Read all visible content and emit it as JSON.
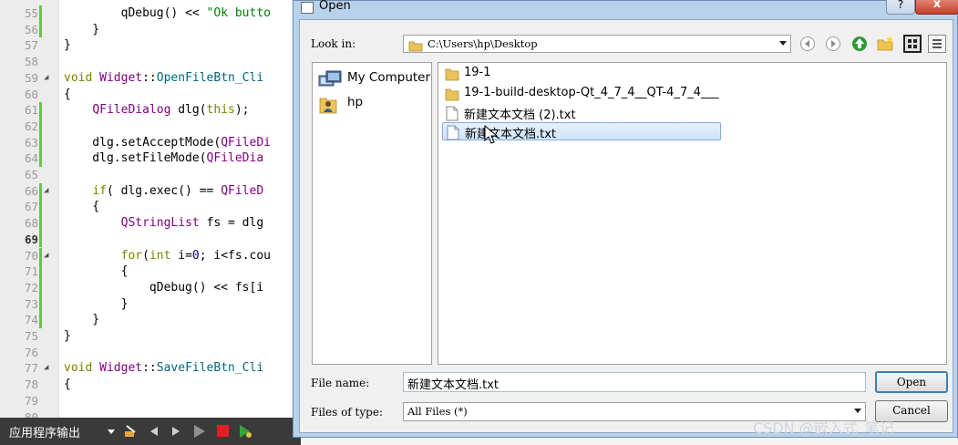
{
  "editor": {
    "lines": [
      {
        "n": "55",
        "code": [
          {
            "c": "        qDebug() << ",
            "t": ""
          },
          {
            "c": "\"Ok butto",
            "t": "str"
          }
        ],
        "change": true
      },
      {
        "n": "56",
        "code": [
          {
            "c": "    }",
            "t": ""
          }
        ],
        "change": true
      },
      {
        "n": "57",
        "code": [
          {
            "c": "}",
            "t": ""
          }
        ]
      },
      {
        "n": "58",
        "code": []
      },
      {
        "n": "59",
        "fold": true,
        "code": [
          {
            "c": "void ",
            "t": "kw"
          },
          {
            "c": "Widget",
            "t": "cls"
          },
          {
            "c": "::",
            "t": ""
          },
          {
            "c": "OpenFileBtn_Cli",
            "t": "fn"
          }
        ]
      },
      {
        "n": "60",
        "code": [
          {
            "c": "{",
            "t": ""
          }
        ]
      },
      {
        "n": "61",
        "code": [
          {
            "c": "    ",
            "t": ""
          },
          {
            "c": "QFileDialog",
            "t": "cls"
          },
          {
            "c": " dlg(",
            "t": ""
          },
          {
            "c": "this",
            "t": "kw"
          },
          {
            "c": ");",
            "t": ""
          }
        ],
        "change": true
      },
      {
        "n": "62",
        "code": [],
        "change": true
      },
      {
        "n": "63",
        "code": [
          {
            "c": "    dlg.setAcceptMode(",
            "t": ""
          },
          {
            "c": "QFileDi",
            "t": "cls"
          }
        ],
        "change": true
      },
      {
        "n": "64",
        "code": [
          {
            "c": "    dlg.setFileMode(",
            "t": ""
          },
          {
            "c": "QFileDia",
            "t": "cls"
          }
        ],
        "change": true
      },
      {
        "n": "65",
        "code": []
      },
      {
        "n": "66",
        "fold": true,
        "code": [
          {
            "c": "    ",
            "t": ""
          },
          {
            "c": "if",
            "t": "kw"
          },
          {
            "c": "( dlg.exec() == ",
            "t": ""
          },
          {
            "c": "QFileD",
            "t": "cls"
          }
        ],
        "change": true
      },
      {
        "n": "67",
        "code": [
          {
            "c": "    {",
            "t": ""
          }
        ],
        "change": true
      },
      {
        "n": "68",
        "code": [
          {
            "c": "        ",
            "t": ""
          },
          {
            "c": "QStringList",
            "t": "cls"
          },
          {
            "c": " fs = dlg",
            "t": ""
          }
        ],
        "change": true
      },
      {
        "n": "69",
        "bold": true,
        "code": [],
        "change": true
      },
      {
        "n": "70",
        "fold": true,
        "code": [
          {
            "c": "        ",
            "t": ""
          },
          {
            "c": "for",
            "t": "kw"
          },
          {
            "c": "(",
            "t": ""
          },
          {
            "c": "int",
            "t": "kw"
          },
          {
            "c": " i=",
            "t": ""
          },
          {
            "c": "0",
            "t": "num"
          },
          {
            "c": "; i<fs.cou",
            "t": ""
          }
        ],
        "change": true
      },
      {
        "n": "71",
        "code": [
          {
            "c": "        {",
            "t": ""
          }
        ],
        "change": true
      },
      {
        "n": "72",
        "code": [
          {
            "c": "            qDebug() << fs[i",
            "t": ""
          }
        ],
        "change": true
      },
      {
        "n": "73",
        "code": [
          {
            "c": "        }",
            "t": ""
          }
        ],
        "change": true
      },
      {
        "n": "74",
        "code": [
          {
            "c": "    }",
            "t": ""
          }
        ],
        "change": true
      },
      {
        "n": "75",
        "code": [
          {
            "c": "}",
            "t": ""
          }
        ]
      },
      {
        "n": "76",
        "code": []
      },
      {
        "n": "77",
        "fold": true,
        "code": [
          {
            "c": "void ",
            "t": "kw"
          },
          {
            "c": "Widget",
            "t": "cls"
          },
          {
            "c": "::",
            "t": ""
          },
          {
            "c": "SaveFileBtn_Cli",
            "t": "fn"
          }
        ]
      },
      {
        "n": "78",
        "code": [
          {
            "c": "{",
            "t": ""
          }
        ]
      },
      {
        "n": "79",
        "code": []
      },
      {
        "n": "80",
        "code": []
      }
    ]
  },
  "output_bar": {
    "label": "应用程序输出"
  },
  "dialog": {
    "title": "Open",
    "help_label": "?",
    "close_label": "x",
    "look_in_label": "Look in:",
    "look_in_path": "C:\\Users\\hp\\Desktop",
    "sidebar_items": [
      {
        "label": "My Computer",
        "icon": "computer-icon"
      },
      {
        "label": "hp",
        "icon": "user-folder-icon"
      }
    ],
    "files": [
      {
        "name": "19-1",
        "icon": "folder-icon",
        "selected": false
      },
      {
        "name": "19-1-build-desktop-Qt_4_7_4__QT-4_7_4___",
        "icon": "folder-icon",
        "selected": false
      },
      {
        "name": "新建文本文档 (2).txt",
        "icon": "text-file-icon",
        "selected": false
      },
      {
        "name": "新建文本文档.txt",
        "icon": "text-file-icon",
        "selected": true
      }
    ],
    "file_name_label": "File name:",
    "file_name_value": "新建文本文档.txt",
    "files_of_type_label": "Files of type:",
    "files_of_type_value": "All Files (*)",
    "open_label": "Open",
    "cancel_label": "Cancel"
  },
  "watermark": "CSDN @嵌入式_笔记",
  "colors": {
    "accent": "#3c7fb1",
    "selection": "#cfe4fa",
    "dialog_frame": "#b9d2ec",
    "gutter_change": "#6cc24a"
  }
}
